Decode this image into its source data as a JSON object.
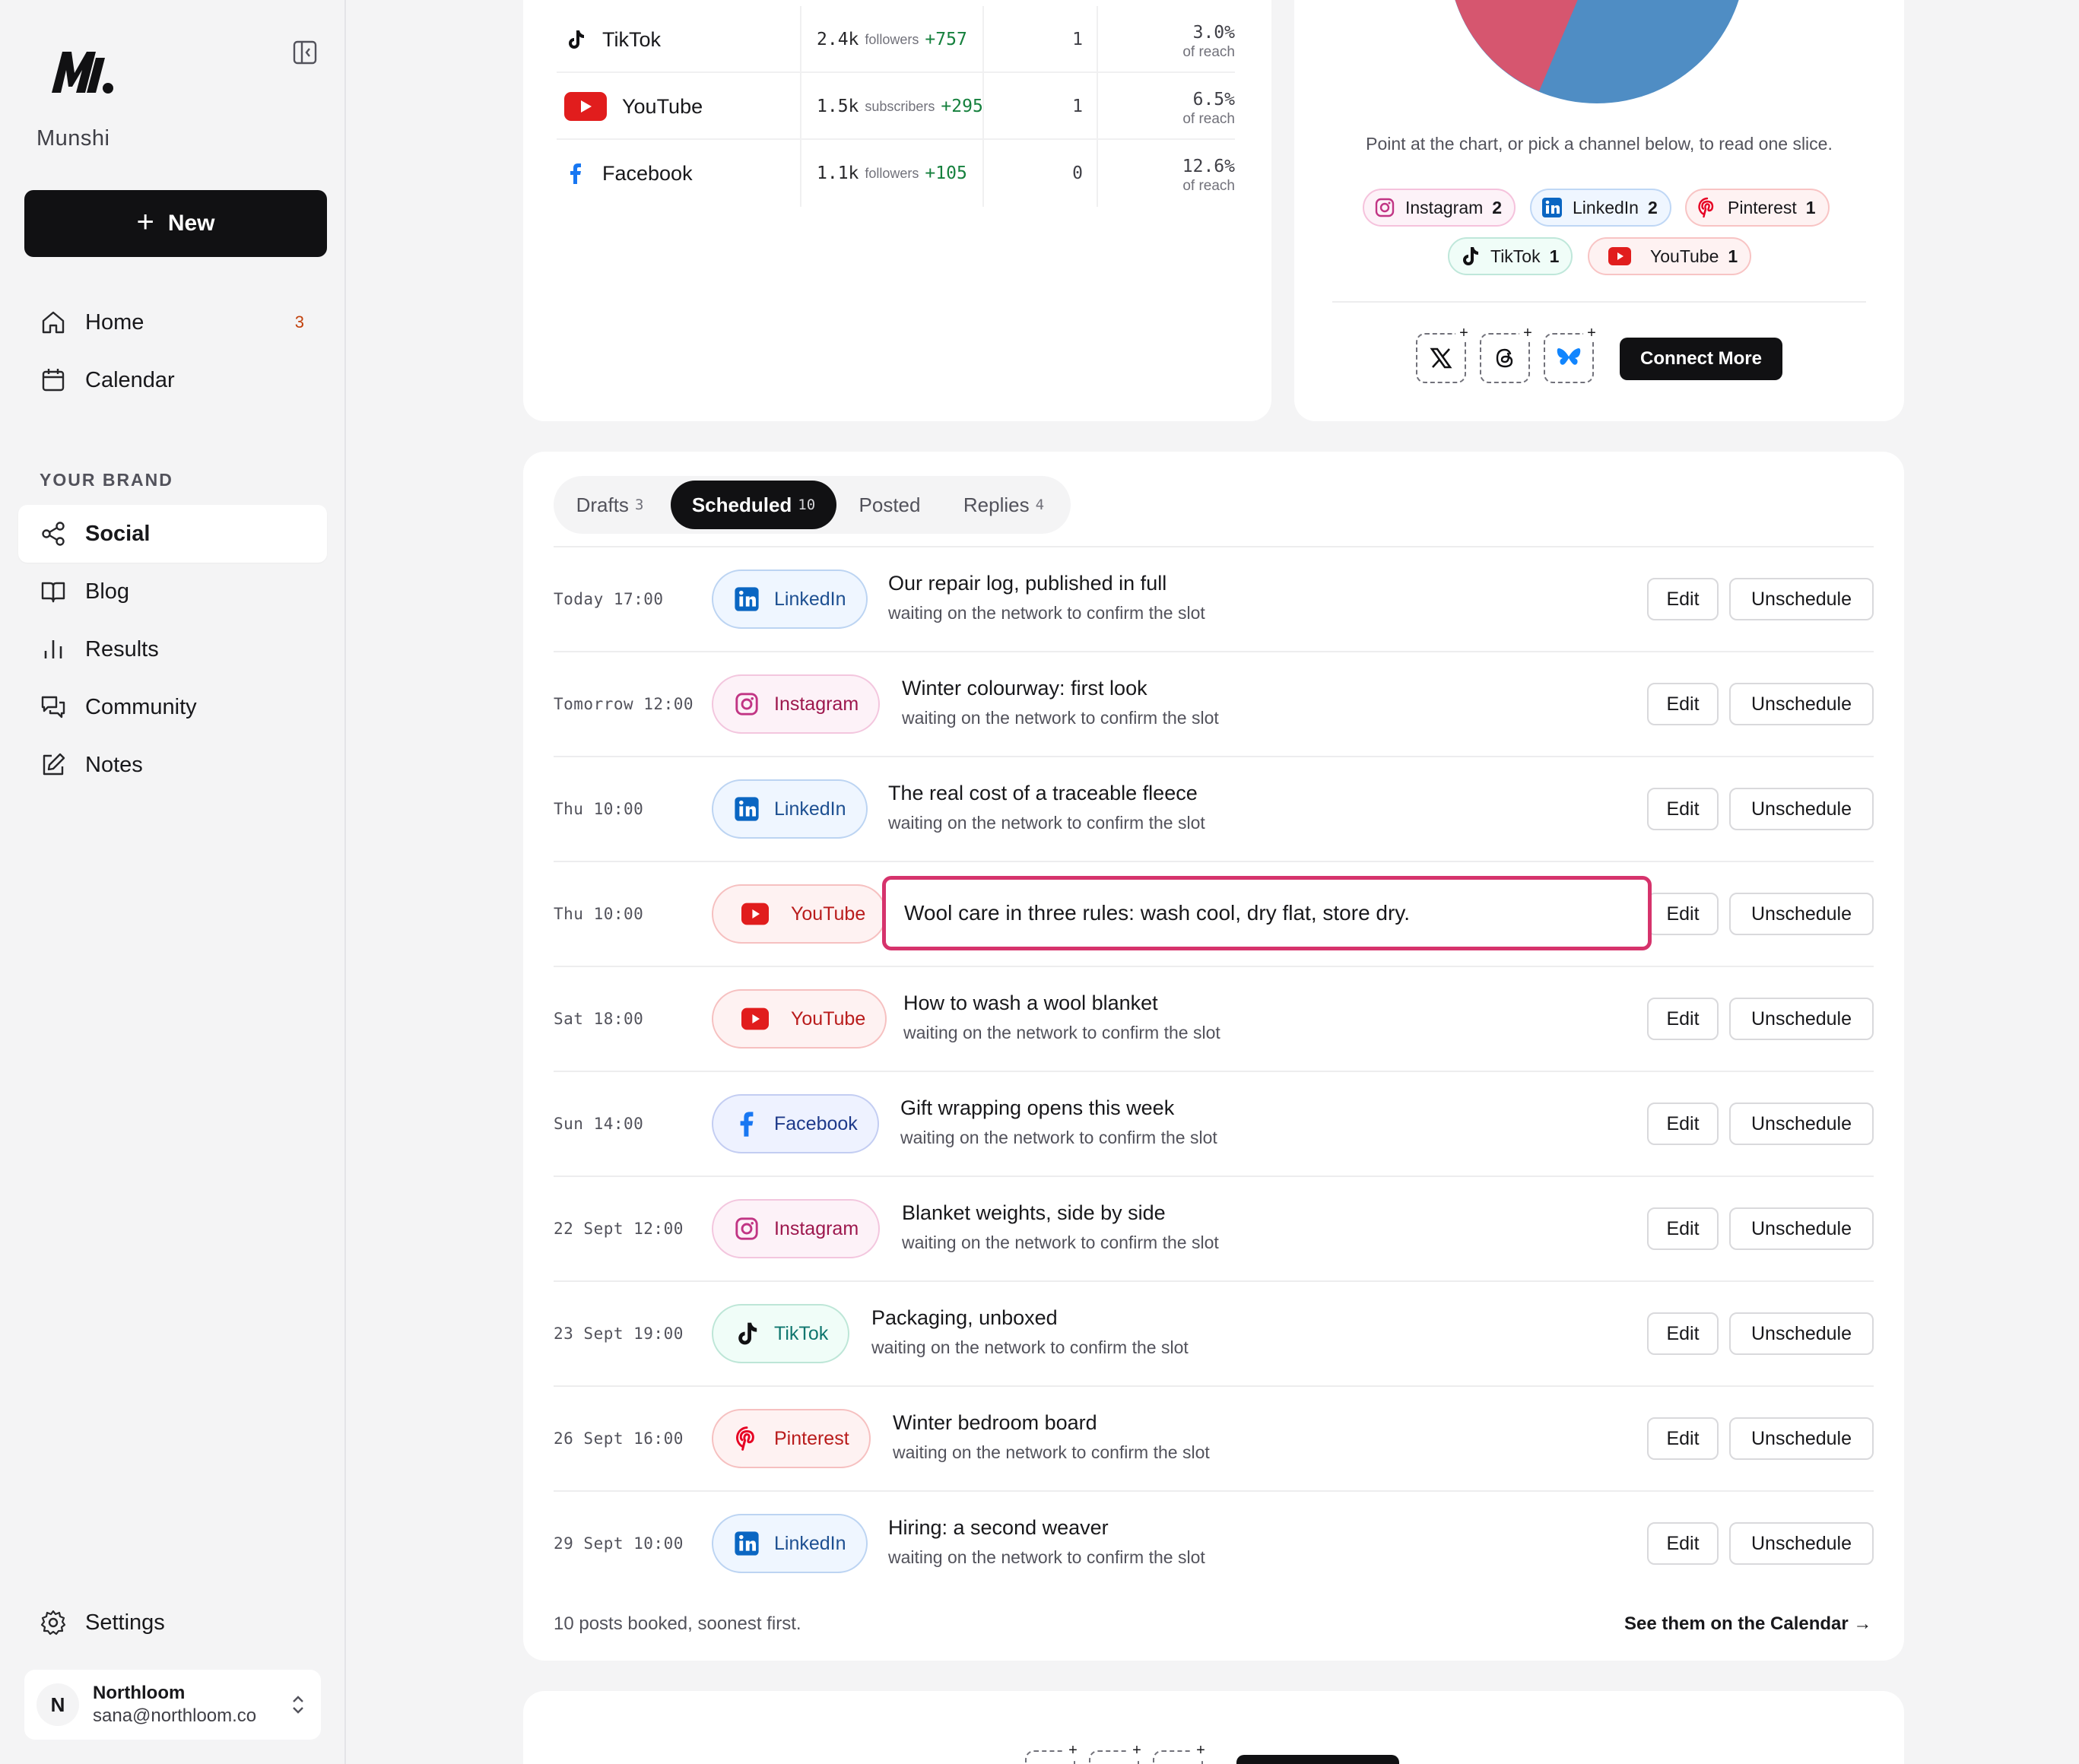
{
  "app": {
    "name": "Munshi"
  },
  "sidebar": {
    "new_label": "New",
    "items": [
      {
        "label": "Home",
        "badge": "3"
      },
      {
        "label": "Calendar"
      }
    ],
    "section_label": "YOUR BRAND",
    "brand_items": [
      {
        "label": "Social",
        "active": true
      },
      {
        "label": "Blog"
      },
      {
        "label": "Results"
      },
      {
        "label": "Community"
      },
      {
        "label": "Notes"
      }
    ],
    "settings_label": "Settings",
    "account": {
      "initial": "N",
      "name": "Northloom",
      "email": "sana@northloom.co"
    }
  },
  "stats": {
    "rows": [
      {
        "channel": "TikTok",
        "count": "2.4k",
        "unit": "followers",
        "delta": "+757",
        "posts": "1",
        "reach": "3.0%",
        "reach_label": "of reach"
      },
      {
        "channel": "YouTube",
        "count": "1.5k",
        "unit": "subscribers",
        "delta": "+295",
        "posts": "1",
        "reach": "6.5%",
        "reach_label": "of reach"
      },
      {
        "channel": "Facebook",
        "count": "1.1k",
        "unit": "followers",
        "delta": "+105",
        "posts": "0",
        "reach": "12.6%",
        "reach_label": "of reach"
      }
    ]
  },
  "mix": {
    "hint": "Point at the chart, or pick a channel below, to read one slice.",
    "chips": [
      {
        "label": "Instagram",
        "count": "2"
      },
      {
        "label": "LinkedIn",
        "count": "2"
      },
      {
        "label": "Pinterest",
        "count": "1"
      },
      {
        "label": "TikTok",
        "count": "1"
      },
      {
        "label": "YouTube",
        "count": "1"
      }
    ],
    "connect_more": "Connect More"
  },
  "colors": {
    "pie_blue": "#4f8dc4",
    "pie_pink": "#d6566f",
    "highlight": "#d6336c",
    "accent_dark": "#111113"
  },
  "queue": {
    "tabs": [
      {
        "label": "Drafts",
        "count": "3"
      },
      {
        "label": "Scheduled",
        "count": "10",
        "active": true
      },
      {
        "label": "Posted",
        "count": ""
      },
      {
        "label": "Replies",
        "count": "4"
      }
    ],
    "edit_label": "Edit",
    "unschedule_label": "Unschedule",
    "rows": [
      {
        "time": "Today 17:00",
        "channel": "LinkedIn",
        "title": "Our repair log, published in full",
        "status": "waiting on the network to confirm the slot"
      },
      {
        "time": "Tomorrow 12:00",
        "channel": "Instagram",
        "title": "Winter colourway: first look",
        "status": "waiting on the network to confirm the slot"
      },
      {
        "time": "Thu 10:00",
        "channel": "LinkedIn",
        "title": "The real cost of a traceable fleece",
        "status": "waiting on the network to confirm the slot"
      },
      {
        "time": "Thu 10:00",
        "channel": "YouTube",
        "title": "Wool care in three rules: wash cool, dry flat, store dry.",
        "status": ""
      },
      {
        "time": "Sat 18:00",
        "channel": "YouTube",
        "title": "How to wash a wool blanket",
        "status": "waiting on the network to confirm the slot"
      },
      {
        "time": "Sun 14:00",
        "channel": "Facebook",
        "title": "Gift wrapping opens this week",
        "status": "waiting on the network to confirm the slot"
      },
      {
        "time": "22 Sept 12:00",
        "channel": "Instagram",
        "title": "Blanket weights, side by side",
        "status": "waiting on the network to confirm the slot"
      },
      {
        "time": "23 Sept 19:00",
        "channel": "TikTok",
        "title": "Packaging, unboxed",
        "status": "waiting on the network to confirm the slot"
      },
      {
        "time": "26 Sept 16:00",
        "channel": "Pinterest",
        "title": "Winter bedroom board",
        "status": "waiting on the network to confirm the slot"
      },
      {
        "time": "29 Sept 10:00",
        "channel": "LinkedIn",
        "title": "Hiring: a second weaver",
        "status": "waiting on the network to confirm the slot"
      }
    ],
    "footer_left": "10 posts booked, soonest first.",
    "footer_right": "See them on the Calendar →"
  }
}
